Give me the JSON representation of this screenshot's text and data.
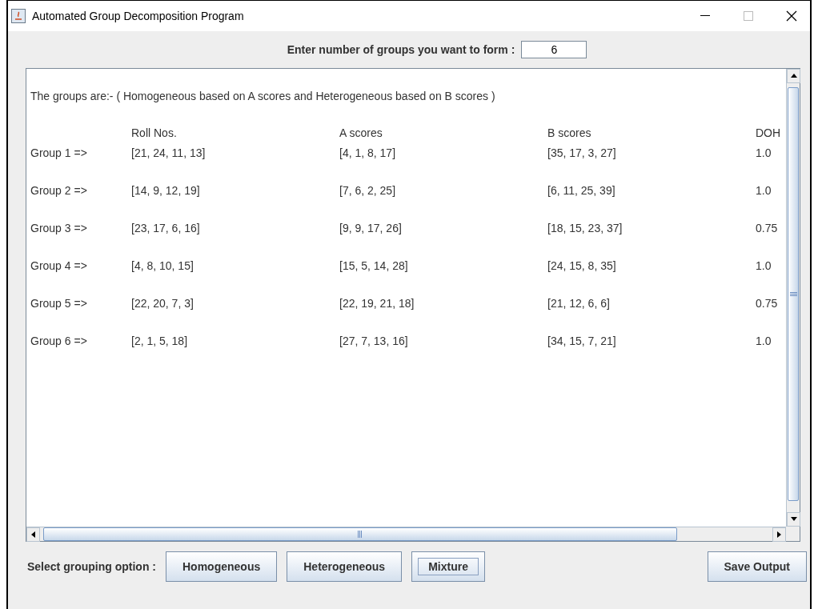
{
  "window": {
    "title": "Automated Group Decomposition Program"
  },
  "group_count": {
    "label": "Enter number of groups you want to form :",
    "value": "6"
  },
  "output": {
    "intro": "The groups are:- ( Homogeneous based on A scores and Heterogeneous based on B scores )",
    "columns": [
      "Roll Nos.",
      "A scores",
      "B scores",
      "DOH"
    ],
    "rows": [
      {
        "group": "Group 1 =>",
        "cells": [
          "[21, 24, 11, 13]",
          "[4, 1, 8, 17]",
          "[35, 17, 3, 27]",
          "1.0"
        ]
      },
      {
        "group": "Group 2 =>",
        "cells": [
          "[14, 9, 12, 19]",
          "[7, 6, 2, 25]",
          "[6, 11, 25, 39]",
          "1.0"
        ]
      },
      {
        "group": "Group 3 =>",
        "cells": [
          "[23, 17, 6, 16]",
          "[9, 9, 17, 26]",
          "[18, 15, 23, 37]",
          "0.75"
        ]
      },
      {
        "group": "Group 4 =>",
        "cells": [
          "[4, 8, 10, 15]",
          "[15, 5, 14, 28]",
          "[24, 15, 8, 35]",
          "1.0"
        ]
      },
      {
        "group": "Group 5 =>",
        "cells": [
          "[22, 20, 7, 3]",
          "[22, 19, 21, 18]",
          "[21, 12, 6, 6]",
          "0.75"
        ]
      },
      {
        "group": "Group 6 =>",
        "cells": [
          "[2, 1, 5, 18]",
          "[27, 7, 13, 16]",
          "[34, 15, 7, 21]",
          "1.0"
        ]
      }
    ]
  },
  "grouping": {
    "label": "Select grouping option :",
    "buttons": [
      {
        "label": "Homogeneous",
        "focused": false
      },
      {
        "label": "Heterogeneous",
        "focused": false
      },
      {
        "label": "Mixture",
        "focused": true
      }
    ]
  },
  "save_button": {
    "label": "Save Output"
  }
}
